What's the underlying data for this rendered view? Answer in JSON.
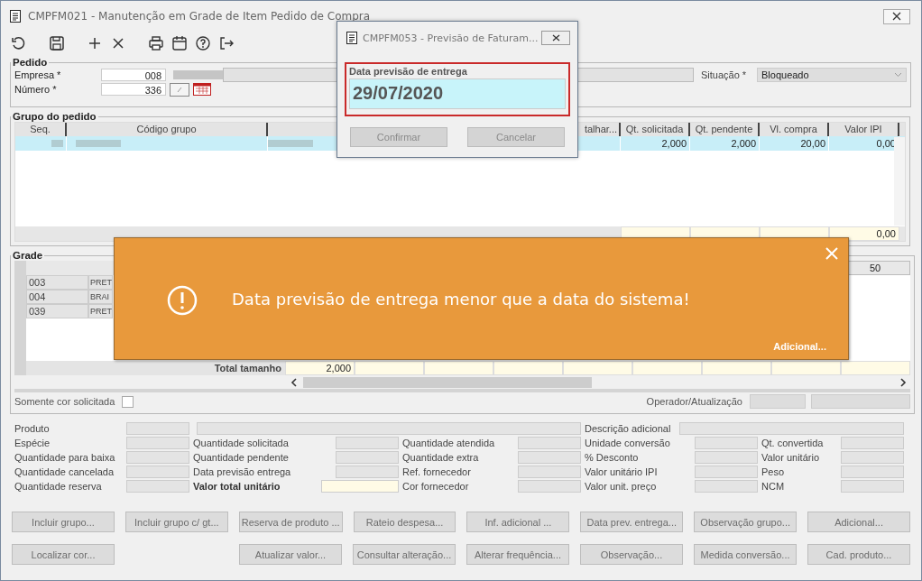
{
  "window": {
    "title": "CMPFM021 - Manutenção em Grade de Item Pedido de Compra"
  },
  "pedido": {
    "title": "Pedido",
    "empresa_label": "Empresa *",
    "empresa_value": "008",
    "numero_label": "Número *",
    "numero_value": "336",
    "situacao_label": "Situação *",
    "situacao_value": "Bloqueado"
  },
  "grupo": {
    "title": "Grupo do pedido",
    "columns": [
      "Seq.",
      "Código grupo",
      "talhar...",
      "Qt. solicitada",
      "Qt. pendente",
      "Vl. compra",
      "Valor IPI"
    ],
    "rows": [
      {
        "selected": true,
        "qt_solicitada": "2,000",
        "qt_pendente": "2,000",
        "vl_compra": "20,00",
        "valor_ipi": "0,00"
      }
    ],
    "total_valor_ipi": "0,00"
  },
  "grade": {
    "title": "Grade",
    "header_value": "50",
    "rows": [
      {
        "code": "003",
        "name": "PRET"
      },
      {
        "code": "004",
        "name": "BRAI"
      },
      {
        "code": "039",
        "name": "PRET"
      }
    ],
    "total_label": "Total tamanho",
    "total_value": "2,000"
  },
  "somente_cor": {
    "label": "Somente cor solicitada",
    "checked": false
  },
  "operador_label": "Operador/Atualização",
  "details": [
    [
      {
        "kind": "field",
        "label": "Produto"
      },
      {
        "kind": "wide"
      },
      {
        "kind": "wide",
        "label": "Descrição adicional"
      }
    ],
    [
      {
        "kind": "field",
        "label": "Espécie"
      },
      {
        "kind": "field",
        "label": "Quantidade solicitada"
      },
      {
        "kind": "field",
        "label": "Quantidade atendida"
      },
      {
        "kind": "field",
        "label": "Unidade conversão"
      },
      {
        "kind": "field",
        "label": "Qt. convertida"
      }
    ],
    [
      {
        "kind": "field",
        "label": "Quantidade para baixa"
      },
      {
        "kind": "field",
        "label": "Quantidade pendente"
      },
      {
        "kind": "field",
        "label": "Quantidade extra"
      },
      {
        "kind": "field",
        "label": "% Desconto"
      },
      {
        "kind": "field",
        "label": "Valor unitário"
      }
    ],
    [
      {
        "kind": "field",
        "label": "Quantidade cancelada"
      },
      {
        "kind": "field",
        "label": "Data previsão entrega"
      },
      {
        "kind": "field",
        "label": "Ref. fornecedor"
      },
      {
        "kind": "field",
        "label": "Valor unitário IPI"
      },
      {
        "kind": "field",
        "label": "Peso"
      }
    ],
    [
      {
        "kind": "field",
        "label": "Quantidade reserva"
      },
      {
        "kind": "total",
        "label": "Valor total unitário"
      },
      {
        "kind": "field",
        "label": "Cor fornecedor"
      },
      {
        "kind": "field",
        "label": "Valor unit. preço"
      },
      {
        "kind": "field",
        "label": "NCM"
      }
    ]
  ],
  "buttons": [
    [
      {
        "kind": "button",
        "label": "Incluir grupo...",
        "disabled": true
      },
      {
        "kind": "button",
        "label": "Incluir grupo c/ gt...",
        "disabled": true
      },
      {
        "kind": "button",
        "label": "Reserva de produto ...",
        "disabled": true
      },
      {
        "kind": "button",
        "label": "Rateio despesa...",
        "disabled": true
      },
      {
        "kind": "button",
        "label": "Inf. adicional ...",
        "disabled": true
      },
      {
        "kind": "button",
        "label": "Data prev. entrega...",
        "disabled": true
      },
      {
        "kind": "button",
        "label": "Observação grupo...",
        "disabled": true
      },
      {
        "kind": "button",
        "label": "Adicional...",
        "disabled": true
      }
    ],
    [
      {
        "kind": "button",
        "label": "Localizar cor...",
        "disabled": true
      },
      {
        "kind": "spacer"
      },
      {
        "kind": "button",
        "label": "Atualizar valor...",
        "disabled": true
      },
      {
        "kind": "button",
        "label": "Consultar alteração...",
        "disabled": true
      },
      {
        "kind": "button",
        "label": "Alterar frequência...",
        "disabled": true
      },
      {
        "kind": "button",
        "label": "Observação...",
        "disabled": true
      },
      {
        "kind": "button",
        "label": "Medida conversão...",
        "disabled": true
      },
      {
        "kind": "button",
        "label": "Cad. produto...",
        "disabled": true
      }
    ]
  ],
  "dialog": {
    "title": "CMPFM053 - Previsão de Faturam...",
    "field_label": "Data previsão de entrega",
    "value": "29/07/2020",
    "buttons": [
      {
        "label": "Confirmar",
        "disabled": true
      },
      {
        "label": "Cancelar",
        "disabled": true
      }
    ]
  },
  "toast": {
    "message": "Data previsão de entrega menor que a data do sistema!",
    "link": "Adicional..."
  }
}
